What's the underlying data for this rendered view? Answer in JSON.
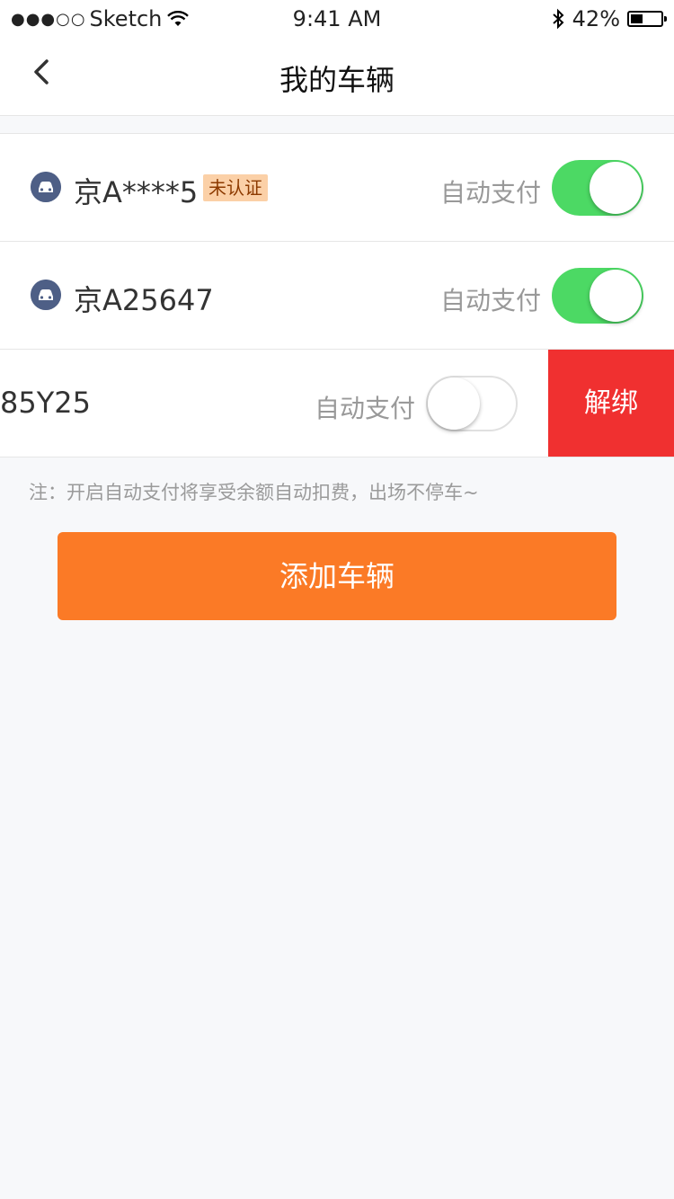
{
  "status_bar": {
    "carrier": "Sketch",
    "time": "9:41 AM",
    "battery": "42%",
    "battery_level": 0.42
  },
  "nav": {
    "title": "我的车辆"
  },
  "vehicles": [
    {
      "plate": "京A****5",
      "badge": "未认证",
      "auto_pay_label": "自动支付",
      "auto_pay_on": true
    },
    {
      "plate": "京A25647",
      "auto_pay_label": "自动支付",
      "auto_pay_on": true
    },
    {
      "plate": "85Y25",
      "auto_pay_label": "自动支付",
      "auto_pay_on": false,
      "unbind_label": "解绑"
    }
  ],
  "note": "注：开启自动支付将享受余额自动扣费，出场不停车~",
  "add_button": "添加车辆",
  "colors": {
    "accent": "#fb7a26",
    "toggle_on": "#4cd964",
    "unbind": "#f03030",
    "badge_bg": "#fbd0a7",
    "car_icon": "#4e5f86"
  }
}
